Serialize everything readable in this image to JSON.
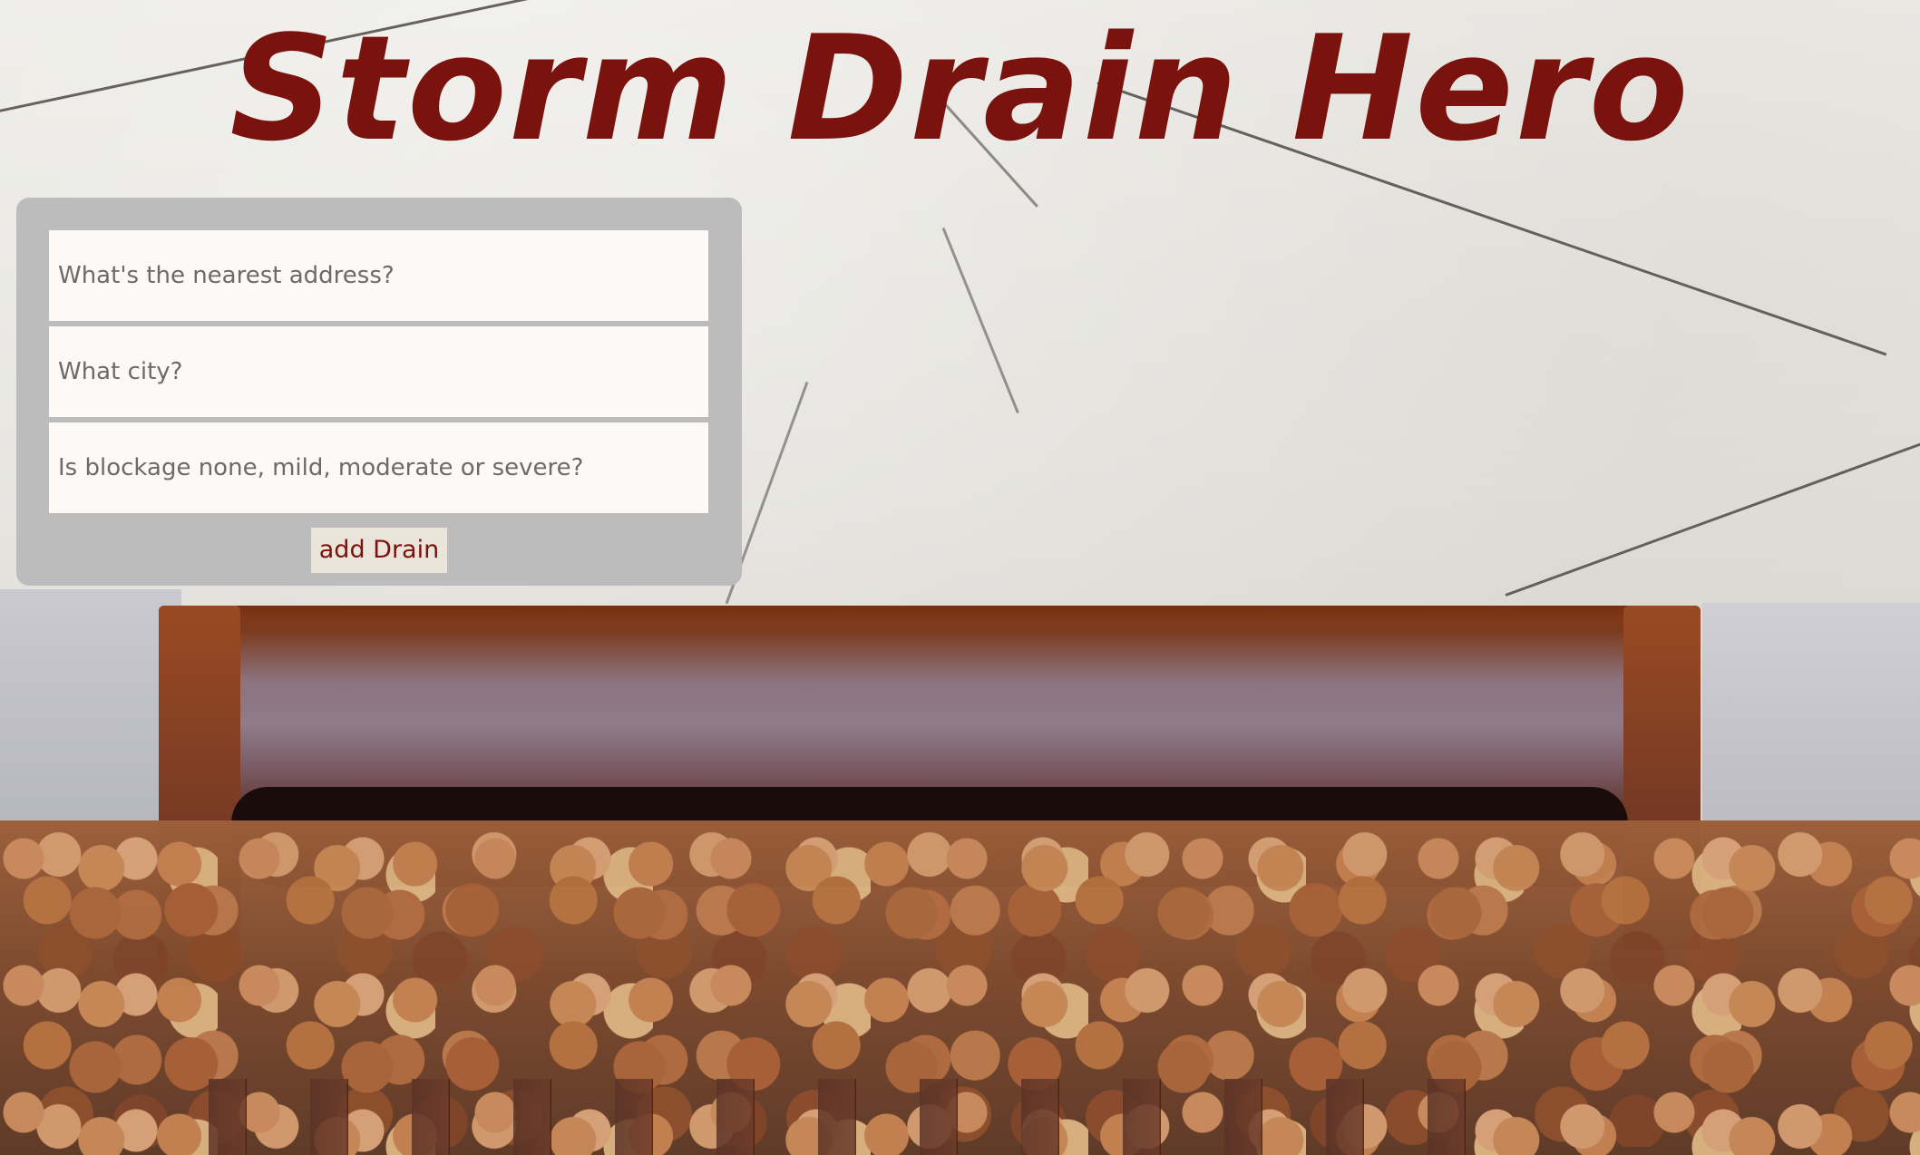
{
  "header": {
    "title": "Storm Drain Hero"
  },
  "form": {
    "address_placeholder": "What's the nearest address?",
    "city_placeholder": "What city?",
    "blockage_placeholder": "Is blockage none, mild, moderate or severe?",
    "submit_label": "add Drain"
  },
  "colors": {
    "title": "#7a120d",
    "form_background": "#bcbcbc",
    "input_background": "#fdf9f7",
    "button_background": "#eae4da",
    "button_text": "#7a120d"
  }
}
